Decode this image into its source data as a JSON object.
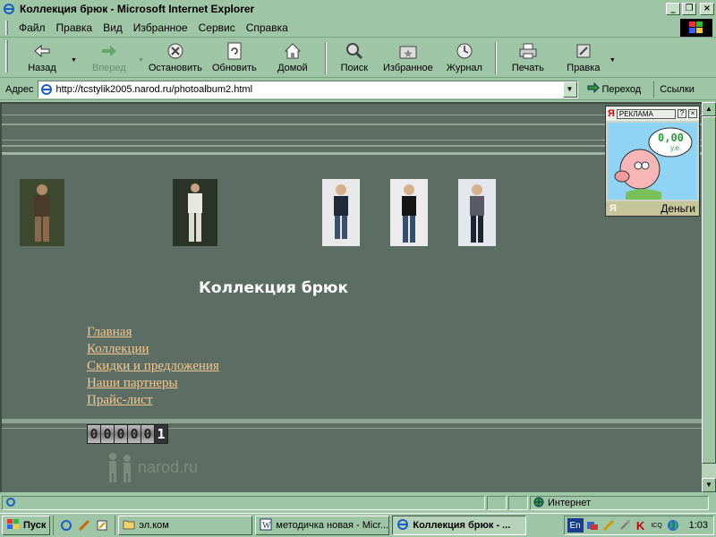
{
  "window": {
    "title": "Коллекция брюк - Microsoft Internet Explorer"
  },
  "menu": [
    "Файл",
    "Правка",
    "Вид",
    "Избранное",
    "Сервис",
    "Справка"
  ],
  "toolbar": {
    "back": "Назад",
    "forward": "Вперед",
    "stop": "Остановить",
    "refresh": "Обновить",
    "home": "Домой",
    "search": "Поиск",
    "favorites": "Избранное",
    "history": "Журнал",
    "print": "Печать",
    "edit": "Правка"
  },
  "address": {
    "label": "Адрес",
    "url": "http://tcstylik2005.narod.ru/photoalbum2.html",
    "go": "Переход",
    "links": "Ссылки"
  },
  "page": {
    "heading": "Коллекция брюк",
    "nav": [
      "Главная",
      "Коллекции",
      "Скидки и предложения",
      "Наши партнеры",
      "Прайс-лист"
    ],
    "counter": [
      "0",
      "0",
      "0",
      "0",
      "0",
      "1"
    ],
    "narod": "narod.ru"
  },
  "ad": {
    "label": "РЕКЛАМА",
    "help": "?",
    "close": "×",
    "bubble": "0,00",
    "bubble_unit": "у.е.",
    "caption": "Деньги",
    "ya": "Я"
  },
  "status": {
    "zone": "Интернет"
  },
  "taskbar": {
    "start": "Пуск",
    "tasks": [
      "эл.ком",
      "методичка новая - Micr...",
      "Коллекция брюк - ..."
    ],
    "lang": "En",
    "clock": "1:03"
  },
  "colors": {
    "link": "#f4c690",
    "page_bg": "#5c6e63",
    "chrome": "#9ec5a5"
  }
}
